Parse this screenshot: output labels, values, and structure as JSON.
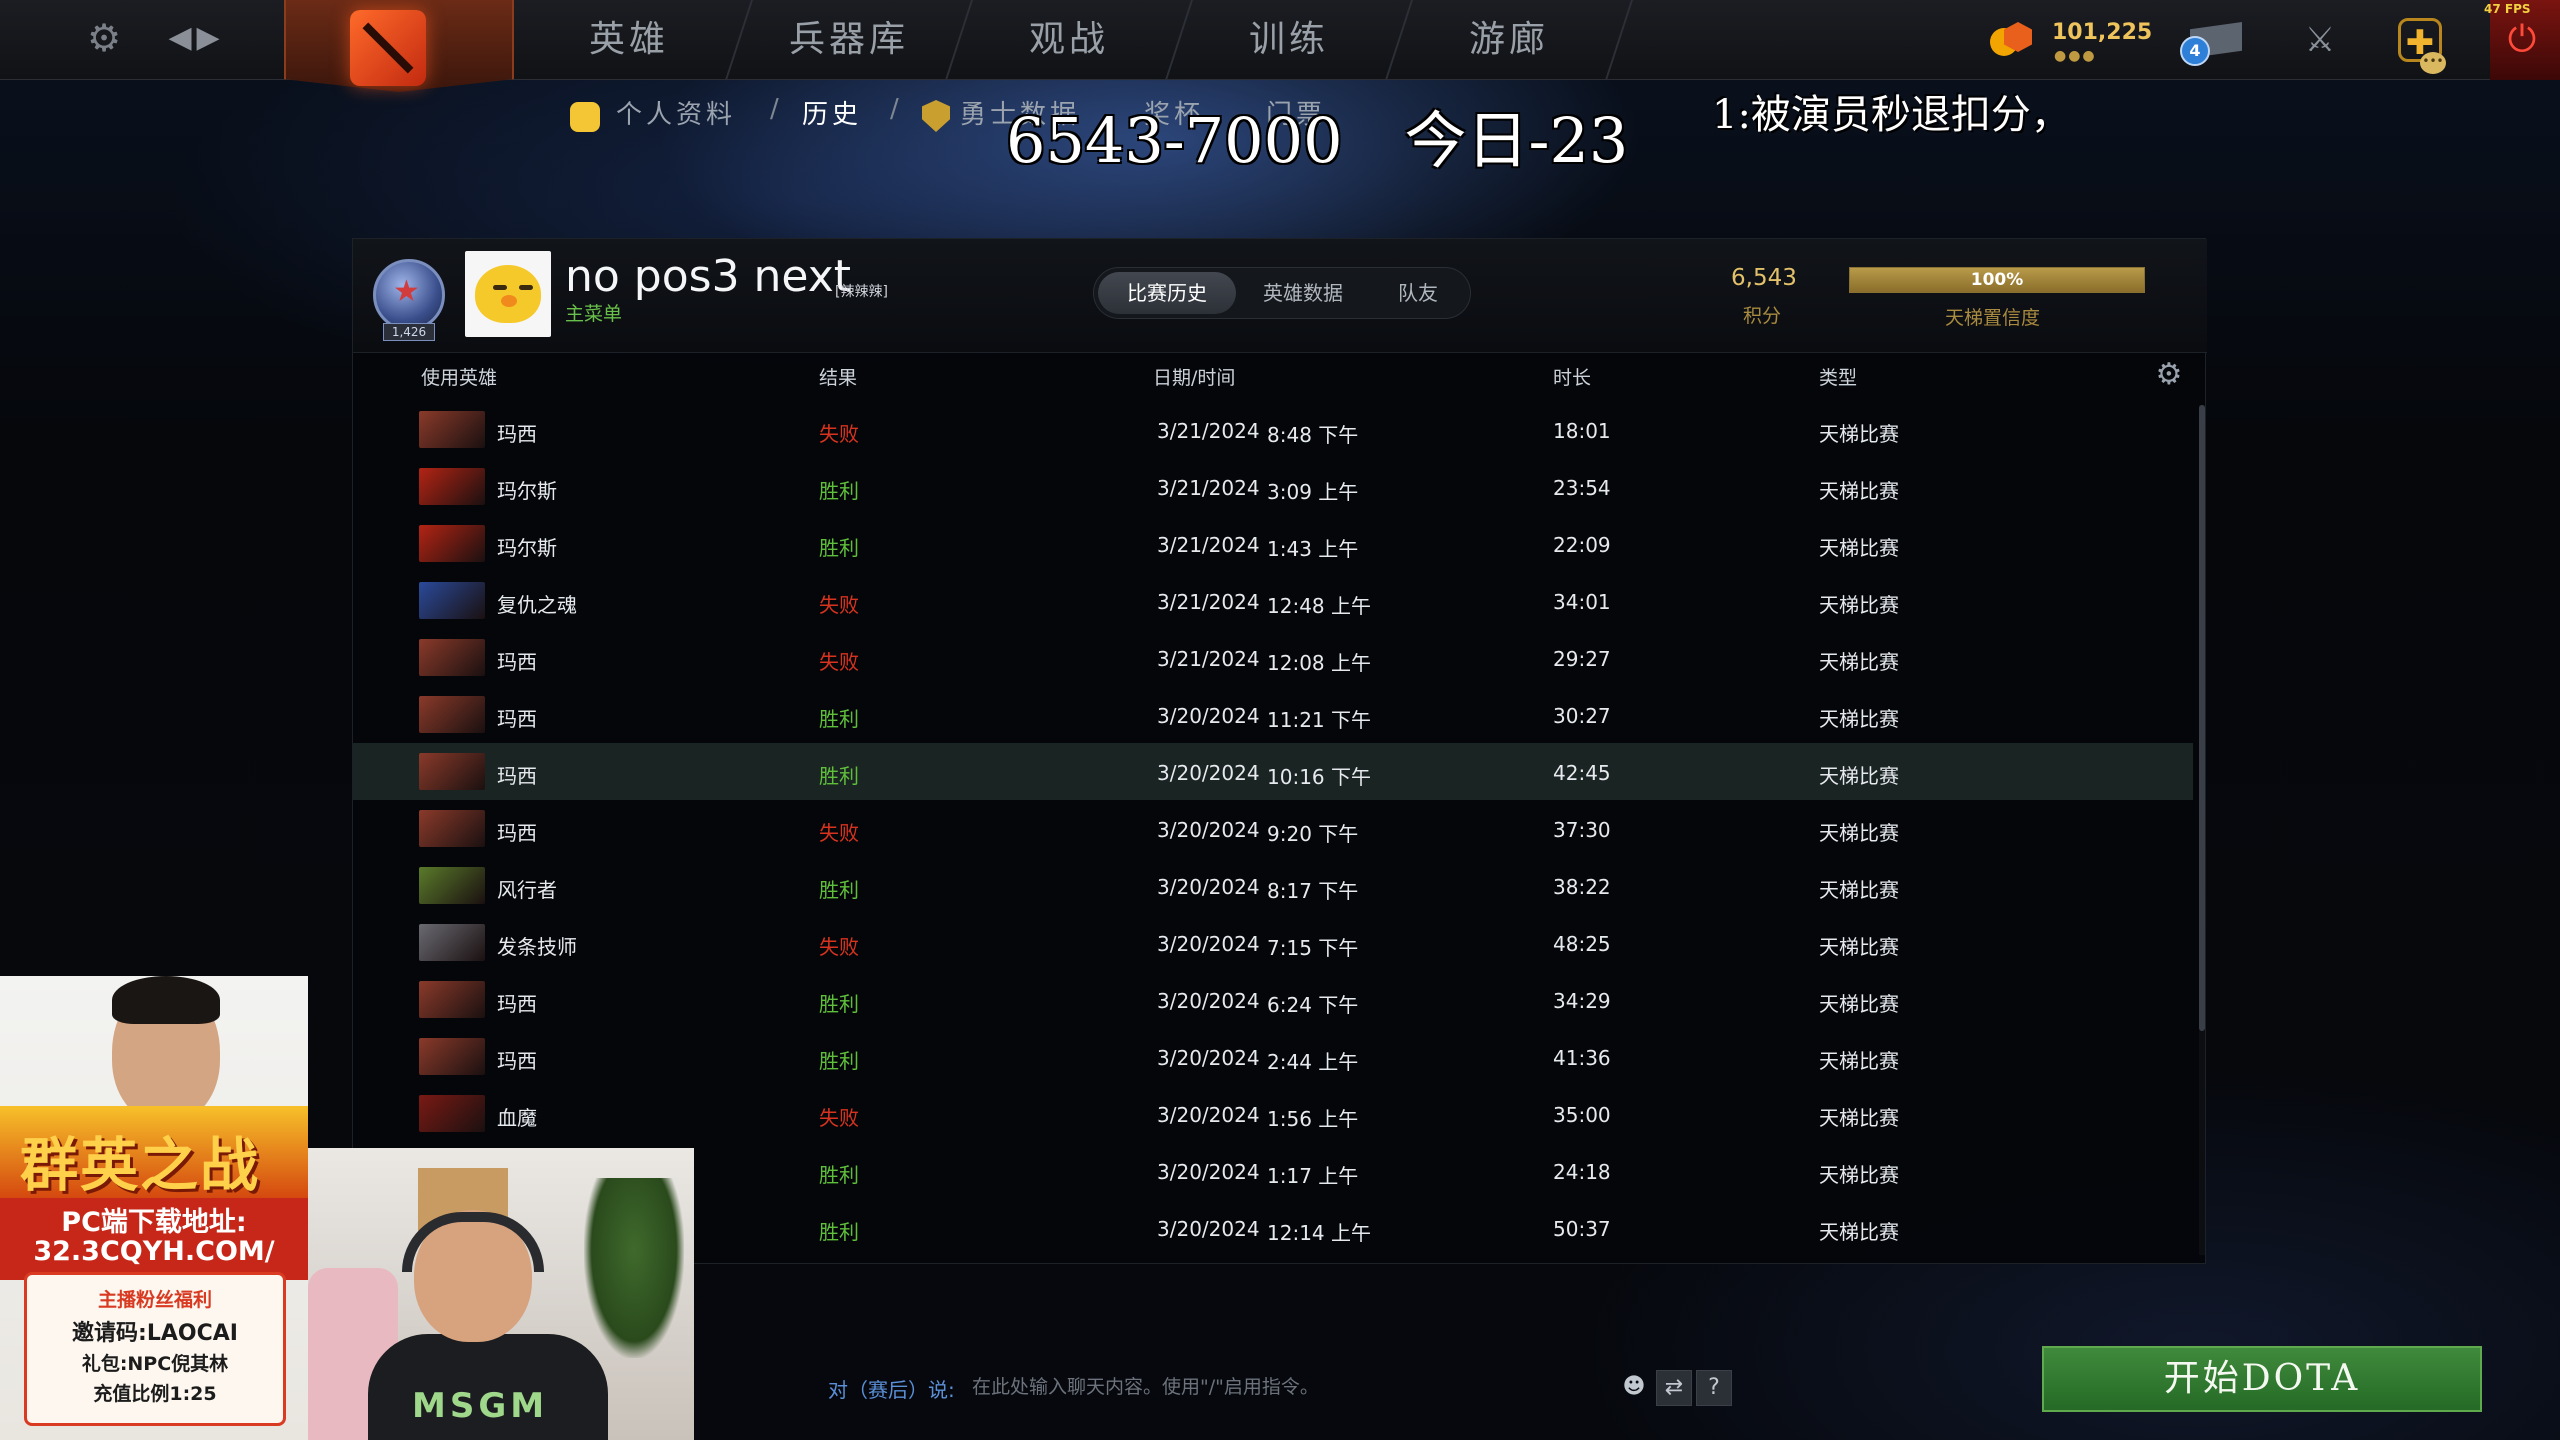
{
  "topbar": {
    "tabs": [
      "英雄",
      "兵器库",
      "观战",
      "训练",
      "游廊"
    ],
    "shards": "101,225",
    "mail_count": "4",
    "fps": "47 FPS"
  },
  "subnav": {
    "profile": "个人资料",
    "history": "历史",
    "stats": "勇士数据",
    "trophies": "奖杯",
    "tickets": "门票",
    "sep": "/"
  },
  "overlay": {
    "score": "6543-7000　今日-23",
    "note": "1:被演员秒退扣分，"
  },
  "profile": {
    "rank_number": "1,426",
    "name": "no pos3 next",
    "tag": "[辣辣辣]",
    "subtitle": "主菜单",
    "mmr": "6,543",
    "mmr_label": "积分",
    "confidence_value": 1.0,
    "confidence_pct": "100%",
    "confidence_label": "天梯置信度"
  },
  "segments": [
    "比赛历史",
    "英雄数据",
    "队友"
  ],
  "columns": {
    "hero": "使用英雄",
    "result": "结果",
    "datetime": "日期/时间",
    "duration": "时长",
    "type": "类型"
  },
  "matches": [
    {
      "hero": "玛西",
      "result": "失败",
      "win": false,
      "date": "3/21/2024",
      "time": "8:48 下午",
      "duration": "18:01",
      "type": "天梯比赛",
      "portrait": "#8a3a2a"
    },
    {
      "hero": "玛尔斯",
      "result": "胜利",
      "win": true,
      "date": "3/21/2024",
      "time": "3:09 上午",
      "duration": "23:54",
      "type": "天梯比赛",
      "portrait": "#b32414"
    },
    {
      "hero": "玛尔斯",
      "result": "胜利",
      "win": true,
      "date": "3/21/2024",
      "time": "1:43 上午",
      "duration": "22:09",
      "type": "天梯比赛",
      "portrait": "#b32414"
    },
    {
      "hero": "复仇之魂",
      "result": "失败",
      "win": false,
      "date": "3/21/2024",
      "time": "12:48 上午",
      "duration": "34:01",
      "type": "天梯比赛",
      "portrait": "#2a4a9a"
    },
    {
      "hero": "玛西",
      "result": "失败",
      "win": false,
      "date": "3/21/2024",
      "time": "12:08 上午",
      "duration": "29:27",
      "type": "天梯比赛",
      "portrait": "#8a3a2a"
    },
    {
      "hero": "玛西",
      "result": "胜利",
      "win": true,
      "date": "3/20/2024",
      "time": "11:21 下午",
      "duration": "30:27",
      "type": "天梯比赛",
      "portrait": "#8a3a2a"
    },
    {
      "hero": "玛西",
      "result": "胜利",
      "win": true,
      "date": "3/20/2024",
      "time": "10:16 下午",
      "duration": "42:45",
      "type": "天梯比赛",
      "portrait": "#8a3a2a"
    },
    {
      "hero": "玛西",
      "result": "失败",
      "win": false,
      "date": "3/20/2024",
      "time": "9:20 下午",
      "duration": "37:30",
      "type": "天梯比赛",
      "portrait": "#8a3a2a"
    },
    {
      "hero": "风行者",
      "result": "胜利",
      "win": true,
      "date": "3/20/2024",
      "time": "8:17 下午",
      "duration": "38:22",
      "type": "天梯比赛",
      "portrait": "#5a7a2a"
    },
    {
      "hero": "发条技师",
      "result": "失败",
      "win": false,
      "date": "3/20/2024",
      "time": "7:15 下午",
      "duration": "48:25",
      "type": "天梯比赛",
      "portrait": "#6a6a72"
    },
    {
      "hero": "玛西",
      "result": "胜利",
      "win": true,
      "date": "3/20/2024",
      "time": "6:24 下午",
      "duration": "34:29",
      "type": "天梯比赛",
      "portrait": "#8a3a2a"
    },
    {
      "hero": "玛西",
      "result": "胜利",
      "win": true,
      "date": "3/20/2024",
      "time": "2:44 上午",
      "duration": "41:36",
      "type": "天梯比赛",
      "portrait": "#8a3a2a"
    },
    {
      "hero": "血魔",
      "result": "失败",
      "win": false,
      "date": "3/20/2024",
      "time": "1:56 上午",
      "duration": "35:00",
      "type": "天梯比赛",
      "portrait": "#7a1a14"
    },
    {
      "hero": "",
      "result": "胜利",
      "win": true,
      "date": "3/20/2024",
      "time": "1:17 上午",
      "duration": "24:18",
      "type": "天梯比赛",
      "portrait": ""
    },
    {
      "hero": "",
      "result": "胜利",
      "win": true,
      "date": "3/20/2024",
      "time": "12:14 上午",
      "duration": "50:37",
      "type": "天梯比赛",
      "portrait": ""
    }
  ],
  "chat": {
    "target": "对（赛后）说:",
    "placeholder": "在此处输入聊天内容。使用\"/\"启用指令。"
  },
  "play_button": "开始DOTA",
  "ad": {
    "title": "群英之战",
    "download_line1": "PC端下载地址:",
    "download_line2": "32.3CQYH.COM/",
    "card_title": "主播粉丝福利",
    "card_code": "邀请码:LAOCAI",
    "card_gift": "礼包:NPC倪其林",
    "card_rate": "充值比例1:25"
  },
  "webcam": {
    "shirt_text": "MSGM"
  },
  "colors": {
    "win": "#5fbf3b",
    "loss": "#d8331f",
    "gold": "#e2c16a",
    "play_green": "#3f8a3c"
  }
}
